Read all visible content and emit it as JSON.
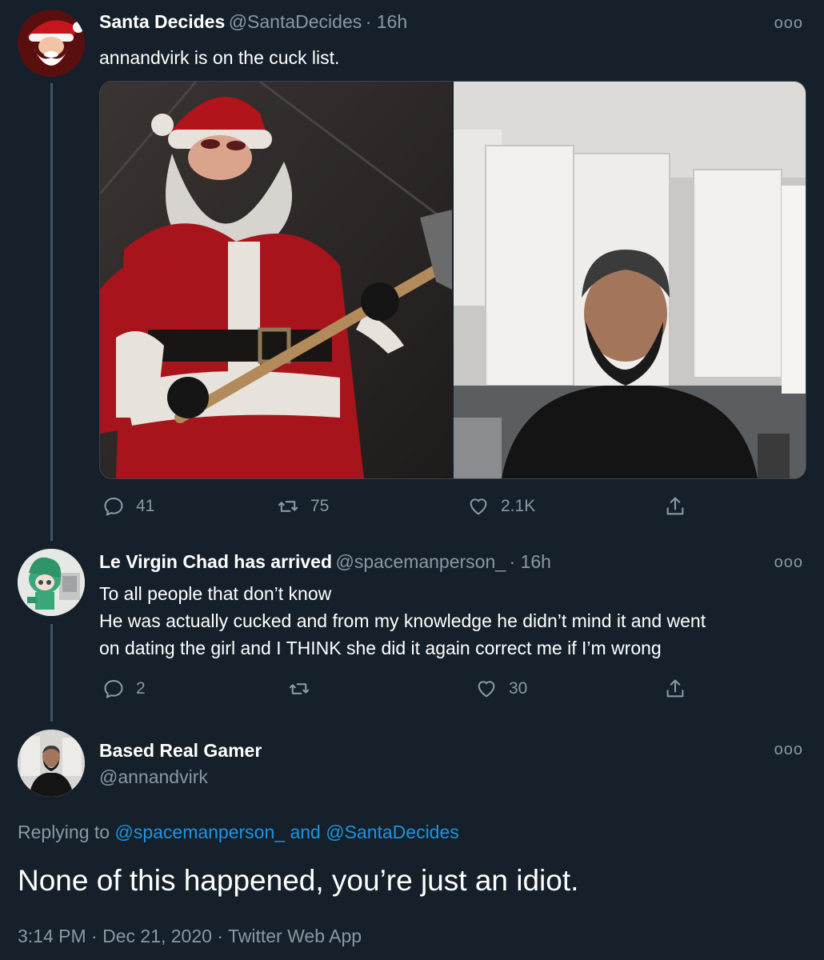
{
  "tweet1": {
    "name": "Santa Decides",
    "handle": "@SantaDecides",
    "time": "· 16h",
    "text": "annandvirk is on the cuck list.",
    "more": "ooo",
    "replies": "41",
    "retweets": "75",
    "likes": "2.1K"
  },
  "tweet2": {
    "name": "Le Virgin Chad has arrived",
    "handle": "@spacemanperson_",
    "time": "· 16h",
    "lines": [
      "To all people that don’t know",
      "He was actually cucked and from my knowledge he didn’t mind it and went",
      "on dating the girl and I THINK she did it again correct me if I’m wrong"
    ],
    "more": "ooo",
    "replies": "2",
    "retweets": "",
    "likes": "30"
  },
  "tweet3": {
    "name": "Based Real Gamer",
    "handle": "@annandvirk",
    "more": "ooo",
    "replying_prefix": "Replying to",
    "replying_user1": "@spacemanperson_",
    "replying_and": "and",
    "replying_user2": "@SantaDecides",
    "text": "None of this happened, you’re just an idiot.",
    "time": "3:14 PM",
    "date": "Dec 21, 2020",
    "source": "Twitter Web App",
    "sep": "·"
  },
  "colors": {
    "background": "#15202b",
    "secondary_text": "#8899a6",
    "link": "#1b95e0",
    "thread_line": "#3d5466"
  }
}
